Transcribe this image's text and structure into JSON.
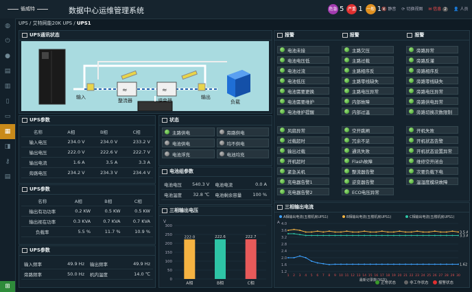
{
  "header": {
    "logo": "循威特",
    "title": "数据中心运维管理系统",
    "alarm_counts": [
      {
        "label": "危急",
        "count": "5",
        "color": "#a33bb0"
      },
      {
        "label": "严重",
        "count": "1",
        "color": "#e03030"
      },
      {
        "label": "一般",
        "count": "1",
        "color": "#e09020"
      }
    ],
    "mute_label": "静音",
    "switch_view_label": "切换视图",
    "messages_label": "信息",
    "messages_count": "2",
    "user_label": "人员"
  },
  "breadcrumb": {
    "items": [
      "UPS",
      "艾特网能20K UPS",
      "UPS1"
    ]
  },
  "ups_comm": {
    "title": "UPS通讯状态",
    "input_label": "输入",
    "rectifier_label": "整流器",
    "inverter_label": "逆变器",
    "output_label": "输出",
    "load_label": "负载"
  },
  "ups_params1": {
    "title": "UPS参数",
    "headers": [
      "名称",
      "A相",
      "B相",
      "C相"
    ],
    "rows": [
      [
        "输入电压",
        "234.0 V",
        "234.0 V",
        "233.2 V"
      ],
      [
        "输出电压",
        "222.0 V",
        "222.6 V",
        "222.7 V"
      ],
      [
        "输出电流",
        "1.6 A",
        "3.5 A",
        "3.3 A"
      ],
      [
        "旁路电压",
        "234.2 V",
        "234.3 V",
        "234.4 V"
      ]
    ]
  },
  "ups_params2": {
    "title": "UPS参数",
    "headers": [
      "名称",
      "A相",
      "B相",
      "C相"
    ],
    "rows": [
      [
        "输出有功功率",
        "0.2 KW",
        "0.5 KW",
        "0.5 KW"
      ],
      [
        "输出视在功率",
        "0.3 KVA",
        "0.7 KVA",
        "0.7 KVA"
      ],
      [
        "负载率",
        "5.5 %",
        "11.7 %",
        "10.9 %"
      ]
    ]
  },
  "ups_params3": {
    "title": "UPS参数",
    "rows": [
      [
        "输入频率",
        "49.9 Hz",
        "输出频率",
        "49.9 Hz"
      ],
      [
        "旁路频率",
        "50.0 Hz",
        "机内温度",
        "14.0 ℃"
      ]
    ]
  },
  "status": {
    "title": "状态",
    "items": [
      {
        "label": "主路供电",
        "color": "green"
      },
      {
        "label": "旁路供电",
        "color": "gray"
      },
      {
        "label": "电池供电",
        "color": "gray"
      },
      {
        "label": "均不供电",
        "color": "gray"
      },
      {
        "label": "电池浮充",
        "color": "gray"
      },
      {
        "label": "电池均充",
        "color": "gray"
      }
    ]
  },
  "battery": {
    "title": "电池组参数",
    "rows": [
      [
        "电池电压",
        "540.3 V",
        "电池电流",
        "0.0 A"
      ],
      [
        "电池温度",
        "32.8 ℃",
        "电池剩余容量",
        "100 %"
      ]
    ]
  },
  "alarm_panels": {
    "title": "报警",
    "columns": [
      [
        "电池未接",
        "电池电压低",
        "电池过流",
        "电池低压",
        "电池需要更换",
        "电池需要维护",
        "电池维护提醒"
      ],
      [
        "主路欠压",
        "主路过载",
        "主路相序反",
        "主路零线缺失",
        "主路电压异常",
        "内部故障",
        "内部过温"
      ],
      [
        "旁路异常",
        "旁路反灌",
        "旁路相序反",
        "旁路零线缺失",
        "旁路电压异常",
        "旁路供电异常",
        "旁路切换次数限制"
      ],
      [
        "风扇异常",
        "过载超时",
        "输出过载",
        "开机超时",
        "紧急关机",
        "充电器告警1",
        "充电器告警2"
      ],
      [
        "空开跳闸",
        "冗余不足",
        "通讯失败",
        "Flash故障",
        "整流器告警",
        "逆变器告警",
        "ECO电压异常"
      ],
      [
        "开机失败",
        "开机状态告警",
        "开机状态设置异常",
        "维修空开闭合",
        "次要负载下电",
        "温湿度模块故障"
      ]
    ]
  },
  "bar_chart": {
    "title": "三相输出电压",
    "chart_data": {
      "type": "bar",
      "categories": [
        "A相",
        "B相",
        "C相"
      ],
      "values": [
        222.0,
        222.6,
        222.7
      ],
      "colors": [
        "#f5b342",
        "#2ec4a6",
        "#e85a5a"
      ],
      "ylim": [
        0,
        300
      ],
      "yticks": [
        0,
        50,
        100,
        150,
        200,
        250,
        300
      ],
      "ylabel": "V",
      "value_labels": [
        "222.0",
        "222.6",
        "222.7"
      ]
    }
  },
  "line_chart": {
    "title": "三相输出电流",
    "chart_data": {
      "type": "line",
      "ylabel": "A",
      "xlabel": "最新记录数(30次)",
      "ylim": [
        1.2,
        4.0
      ],
      "yticks": [
        1.2,
        1.6,
        2.0,
        2.4,
        2.8,
        3.2,
        3.6,
        4.0
      ],
      "x": [
        1,
        2,
        3,
        4,
        5,
        6,
        7,
        8,
        9,
        10,
        11,
        12,
        13,
        14,
        15,
        16,
        17,
        18,
        19,
        20,
        21,
        22,
        23,
        24,
        25,
        26,
        27,
        28,
        29,
        30
      ],
      "series": [
        {
          "name": "A相输出电流(五楼机房UPS1)",
          "color": "#3da1ff",
          "values": [
            2.0,
            2.0,
            2.1,
            2.0,
            1.8,
            1.7,
            1.65,
            1.6,
            1.62,
            1.62,
            1.62,
            1.62,
            1.62,
            1.62,
            1.62,
            1.62,
            1.62,
            1.62,
            1.62,
            1.62,
            1.62,
            1.62,
            1.62,
            1.62,
            1.62,
            1.62,
            1.62,
            1.62,
            1.62,
            1.62
          ],
          "labels": [
            "2.0 A",
            "1.5 A",
            "1.62 A"
          ]
        },
        {
          "name": "B相输出电流(五楼机房UPS1)",
          "color": "#f5b342",
          "values": [
            3.6,
            3.65,
            3.6,
            3.5,
            3.5,
            3.55,
            3.5,
            3.55,
            3.5,
            3.5,
            3.55,
            3.5,
            3.5,
            3.55,
            3.5,
            3.5,
            3.55,
            3.5,
            3.5,
            3.55,
            3.5,
            3.5,
            3.55,
            3.5,
            3.5,
            3.55,
            3.5,
            3.5,
            3.55,
            3.5
          ],
          "labels": [
            "3.5 A"
          ]
        },
        {
          "name": "C相输出电流(五楼机房UPS1)",
          "color": "#2ec4a6",
          "values": [
            3.4,
            3.4,
            3.35,
            3.3,
            3.3,
            3.3,
            3.3,
            3.3,
            3.3,
            3.3,
            3.3,
            3.3,
            3.3,
            3.3,
            3.3,
            3.3,
            3.3,
            3.3,
            3.3,
            3.3,
            3.3,
            3.3,
            3.3,
            3.3,
            3.3,
            3.3,
            3.3,
            3.3,
            3.3,
            3.3
          ],
          "labels": [
            "3.3 A"
          ]
        }
      ],
      "legend": [
        {
          "label": "正常状态",
          "color": "#3a9a2a"
        },
        {
          "label": "非工作状态",
          "color": "#666"
        },
        {
          "label": "报警状态",
          "color": "#e03030"
        }
      ]
    }
  }
}
